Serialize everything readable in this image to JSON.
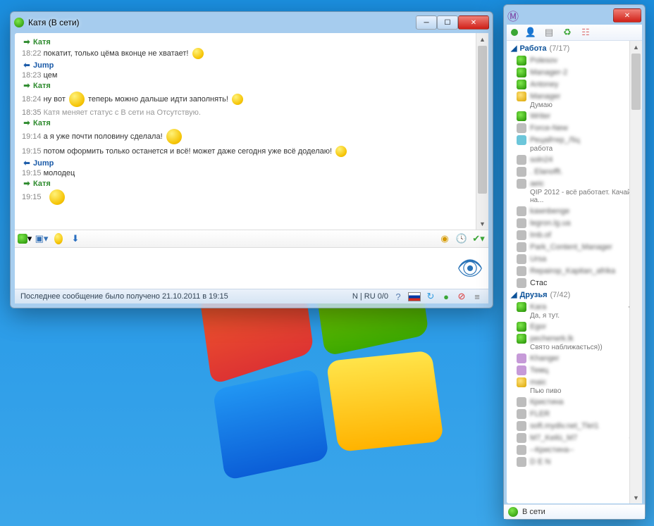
{
  "chat": {
    "title": "Катя (В сети)",
    "messages": [
      {
        "who": "Катя",
        "dir": "in"
      },
      {
        "time": "18:22",
        "text": "покатит, только цёма вконце не хватает!"
      },
      {
        "who": "Jump",
        "dir": "out"
      },
      {
        "time": "18:23",
        "text": "цем"
      },
      {
        "who": "Катя",
        "dir": "in"
      },
      {
        "time": "18:24",
        "text_a": "ну вот",
        "text_b": "теперь можно дальше идти заполнять!"
      },
      {
        "sys_time": "18:35",
        "sys": "Катя меняет статус с В сети на Отсутствую."
      },
      {
        "who": "Катя",
        "dir": "in"
      },
      {
        "time": "19:14",
        "text": "а я уже почти половину сделала!"
      },
      {
        "time": "19:15",
        "text": "потом оформить только останется и всё! может даже сегодня уже всё доделаю!"
      },
      {
        "who": "Jump",
        "dir": "out"
      },
      {
        "time": "19:15",
        "text": "молодец"
      },
      {
        "who": "Катя",
        "dir": "in"
      },
      {
        "time": "19:15"
      }
    ],
    "status_left": "Последнее сообщение было получено 21.10.2011 в 19:15",
    "status_center": "N | RU 0/0"
  },
  "contacts": {
    "groups": {
      "work": {
        "label": "Работа",
        "count": "(7/17)"
      },
      "friends": {
        "label": "Друзья",
        "count": "(7/42)"
      }
    },
    "work_items": [
      {
        "s": "on",
        "name": "Polesov"
      },
      {
        "s": "on",
        "name": "Manager-2"
      },
      {
        "s": "on",
        "name": "Antoney"
      },
      {
        "s": "away",
        "name": "Manager",
        "sub": "Думаю"
      },
      {
        "s": "on",
        "name": "Writer"
      },
      {
        "s": "off",
        "name": "Force-New"
      },
      {
        "s": "sp",
        "name": "Рецайтер_Ліц",
        "sub": "работа",
        "ric": "🖼"
      },
      {
        "s": "off",
        "name": "soln24",
        "ric": "🖼"
      },
      {
        "s": "off",
        "name": ". Elanofft."
      },
      {
        "s": "off",
        "name": "aeic",
        "sub": "QIP 2012 - всё работает. Качай на..."
      },
      {
        "s": "off",
        "name": "kawnbenge"
      },
      {
        "s": "off",
        "name": "legron.lg.ua"
      },
      {
        "s": "off",
        "name": "lmb.of",
        "ric": "👩"
      },
      {
        "s": "off",
        "name": "Park_Content_Manager"
      },
      {
        "s": "off",
        "name": "Ursa"
      },
      {
        "s": "off",
        "name": "Repairop_Kapitan_afrika"
      },
      {
        "s": "off",
        "name": "Стас",
        "clear": true
      }
    ],
    "friends_items": [
      {
        "s": "on",
        "name": "Kara",
        "sub": "Да, я тут.",
        "ric": "👁"
      },
      {
        "s": "on",
        "name": "Egor",
        "ric": "📄"
      },
      {
        "s": "on",
        "name": "pecherwrk.lk",
        "sub": "Свято наближається))",
        "ric": "🧩"
      },
      {
        "s": "na",
        "name": "Khanger"
      },
      {
        "s": "na",
        "name": "Темц"
      },
      {
        "s": "away",
        "name": "maic",
        "sub": "Пью пиво"
      },
      {
        "s": "off",
        "name": "Кристина"
      },
      {
        "s": "off",
        "name": "FLER"
      },
      {
        "s": "off",
        "name": "soft.mydiv.net_TleI1"
      },
      {
        "s": "off",
        "name": "M7_Keilù_М7",
        "ric": "⚫"
      },
      {
        "s": "off",
        "name": "--Кристина--"
      },
      {
        "s": "off",
        "name": "D E N"
      }
    ],
    "status_label": "В сети"
  }
}
